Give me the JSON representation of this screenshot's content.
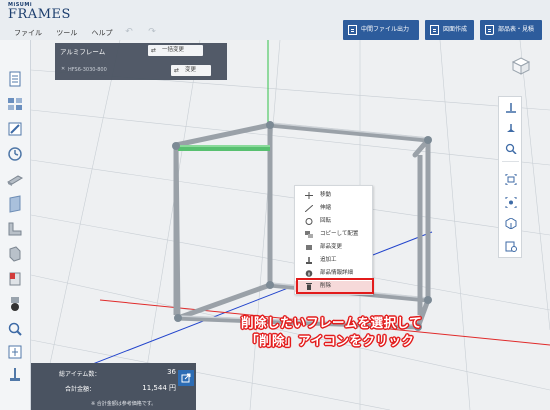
{
  "app": {
    "logo_small": "MiSUMi",
    "logo_main": "FRAMES"
  },
  "menu": [
    "ファイル",
    "ツール",
    "ヘルプ"
  ],
  "header_buttons": [
    {
      "label": "中間ファイル出力",
      "icon": "export-file-icon"
    },
    {
      "label": "図面作成",
      "icon": "drawing-icon"
    },
    {
      "label": "部品表・見積",
      "icon": "cart-icon"
    }
  ],
  "frame_panel": {
    "title": "アルミフレーム",
    "bulk_change_label": "一括変更",
    "part_number": "HFS6-3030-800",
    "change_label": "変更"
  },
  "context_menu": [
    {
      "label": "移動",
      "icon": "move-icon"
    },
    {
      "label": "伸縮",
      "icon": "stretch-icon"
    },
    {
      "label": "回転",
      "icon": "rotate-icon"
    },
    {
      "label": "コピーして配置",
      "icon": "copy-place-icon"
    },
    {
      "label": "部品変更",
      "icon": "part-change-icon"
    },
    {
      "label": "追加工",
      "icon": "additional-machining-icon"
    },
    {
      "label": "部品情報詳細",
      "icon": "info-icon"
    },
    {
      "label": "削除",
      "icon": "trash-icon",
      "highlighted": true
    }
  ],
  "instruction": {
    "line1": "削除したいフレームを選択して",
    "line2": "「削除」アイコンをクリック"
  },
  "summary": {
    "total_items_label": "総アイテム数：",
    "total_items_value": "36",
    "total_amount_label": "合計金額：",
    "total_amount_value": "11,544 円",
    "note": "※ 合計金額は参考価格です。"
  },
  "colors": {
    "header_button": "#2d5c9c",
    "selected_frame": "#58c070",
    "highlight_red": "#e21b1b",
    "panel_bg": "#4a5361"
  }
}
